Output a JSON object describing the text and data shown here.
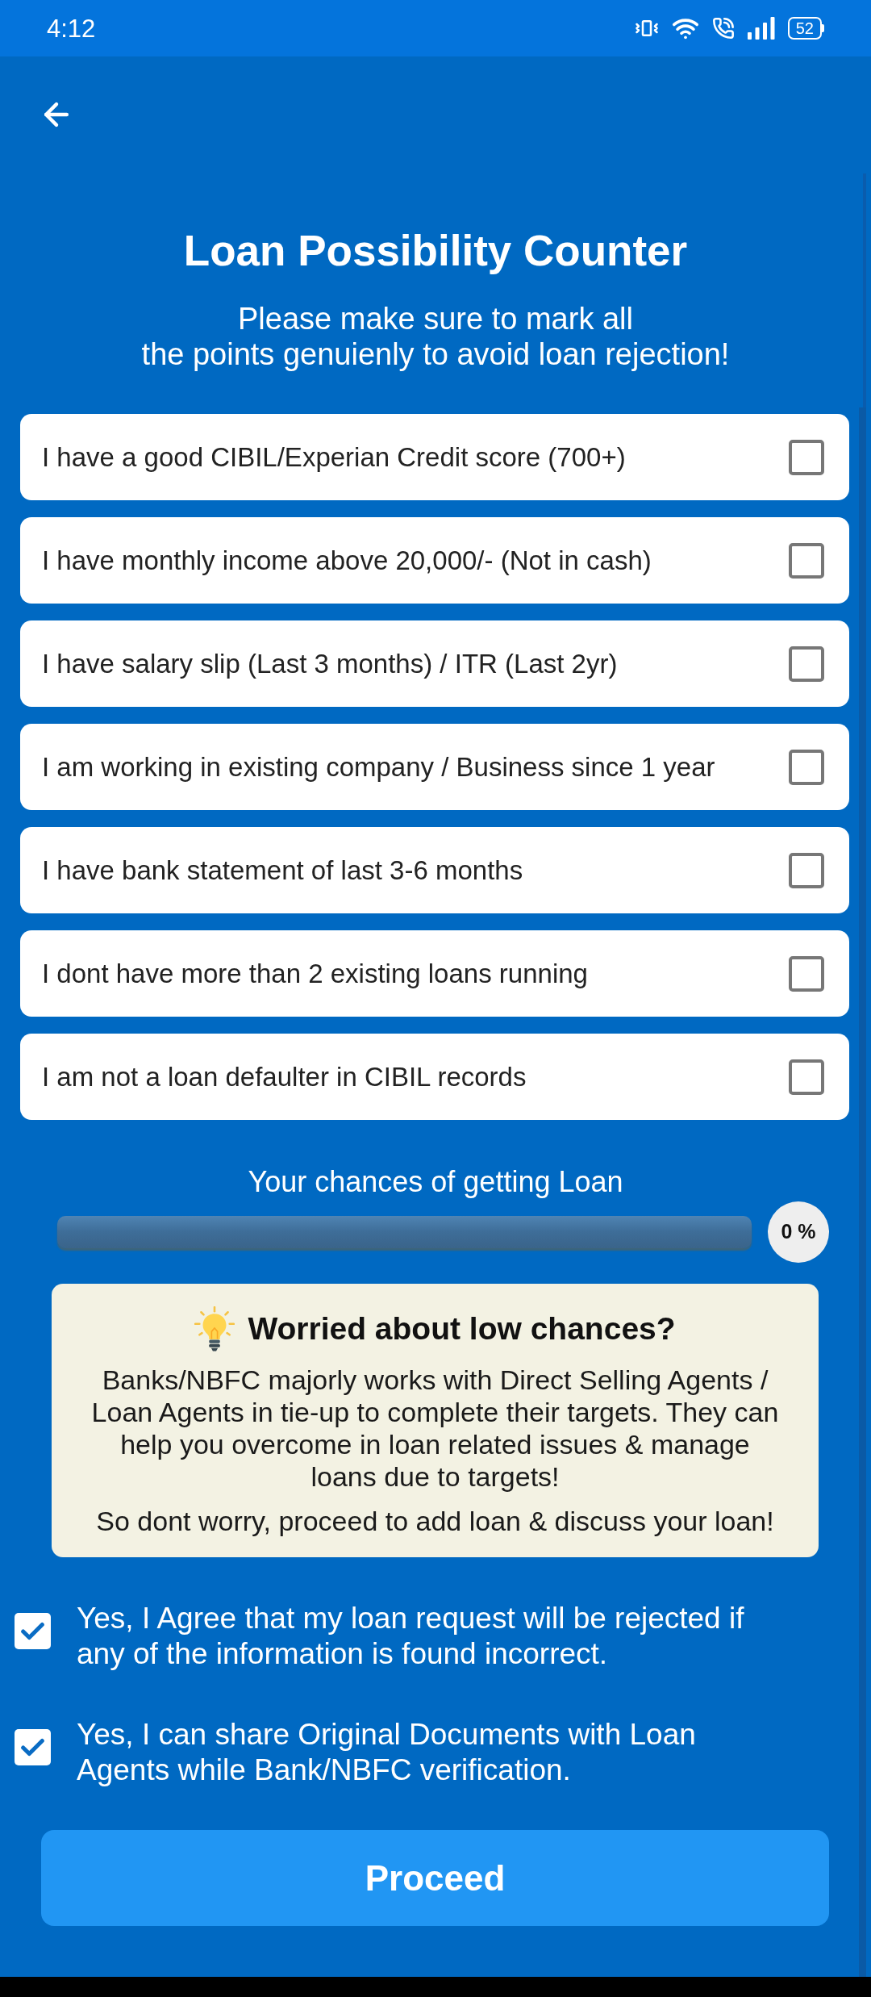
{
  "status_bar": {
    "time": "4:12",
    "battery": "52"
  },
  "header": {
    "title": "Loan Possibility Counter",
    "subtitle_lines": [
      "Please make sure to mark all",
      "the points genuienly to avoid loan rejection!"
    ]
  },
  "checklist": [
    {
      "label": "I have a good CIBIL/Experian Credit score (700+)",
      "checked": false
    },
    {
      "label": "I have monthly income above 20,000/- (Not in cash)",
      "checked": false
    },
    {
      "label": "I have salary slip (Last 3 months) / ITR (Last 2yr)",
      "checked": false
    },
    {
      "label": "I am working in existing company / Business since 1 year",
      "checked": false
    },
    {
      "label": "I have bank statement of last 3-6 months",
      "checked": false
    },
    {
      "label": "I dont have more than 2 existing loans running",
      "checked": false
    },
    {
      "label": "I am not a loan defaulter in CIBIL records",
      "checked": false
    }
  ],
  "chances": {
    "label": "Your chances of getting Loan",
    "percent": "0 %"
  },
  "info_card": {
    "title": "Worried about low chances?",
    "paragraphs": [
      "Banks/NBFC majorly works with Direct Selling Agents / Loan Agents in tie-up to complete their targets. They can help you overcome in loan related issues & manage loans due to targets!",
      "So dont worry, proceed to add loan & discuss your loan!"
    ]
  },
  "agreements": [
    {
      "label": "Yes, I Agree that my loan request will be rejected if any of the information is found incorrect.",
      "checked": true
    },
    {
      "label": "Yes, I can share Original Documents with Loan Agents while Bank/NBFC verification.",
      "checked": true
    }
  ],
  "proceed_button": {
    "label": "Proceed"
  }
}
